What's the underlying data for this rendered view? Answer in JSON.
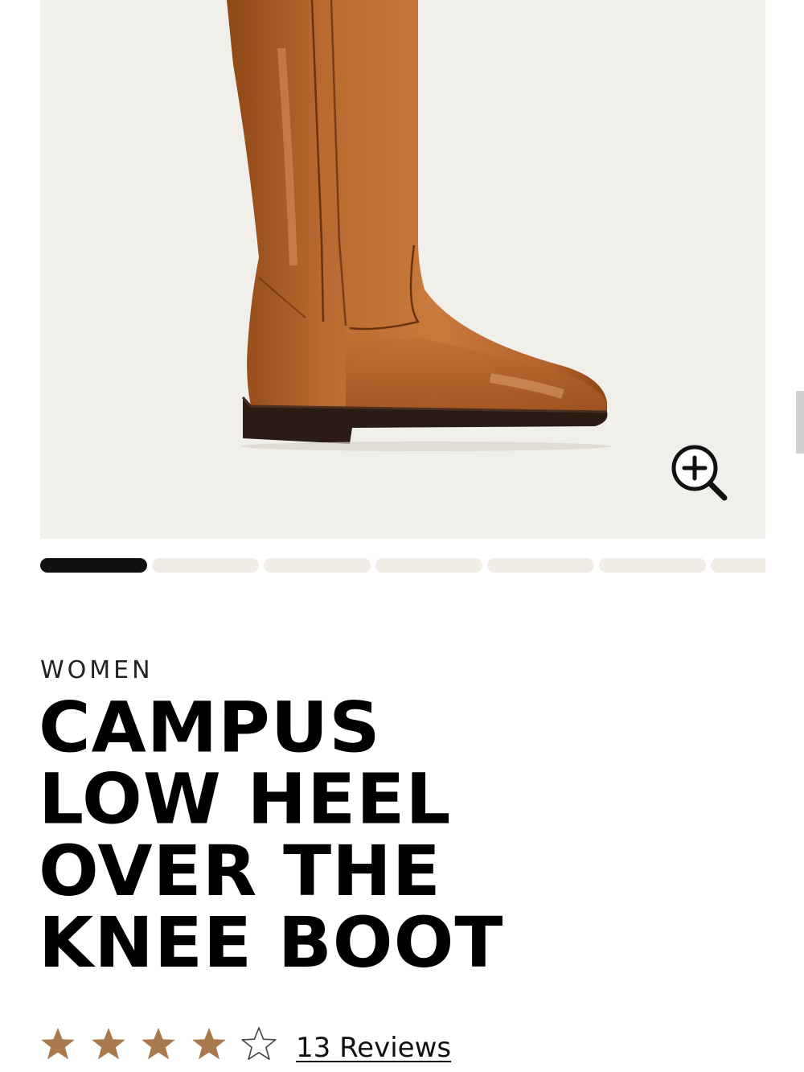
{
  "product": {
    "category": "WOMEN",
    "title_lines": [
      "CAMPUS",
      "LOW HEEL",
      "OVER THE",
      "KNEE BOOT"
    ]
  },
  "gallery": {
    "image": "boot-photo",
    "zoom_icon": "zoom-in-icon",
    "slide_count": 7,
    "active_slide": 1
  },
  "rating": {
    "value": 4,
    "max": 5,
    "star_color": "#a9794d",
    "reviews_label": "13 Reviews"
  },
  "colors": {
    "image_background": "#f1efea",
    "pager_active": "#111111",
    "pager_inactive": "#f1ede6"
  }
}
